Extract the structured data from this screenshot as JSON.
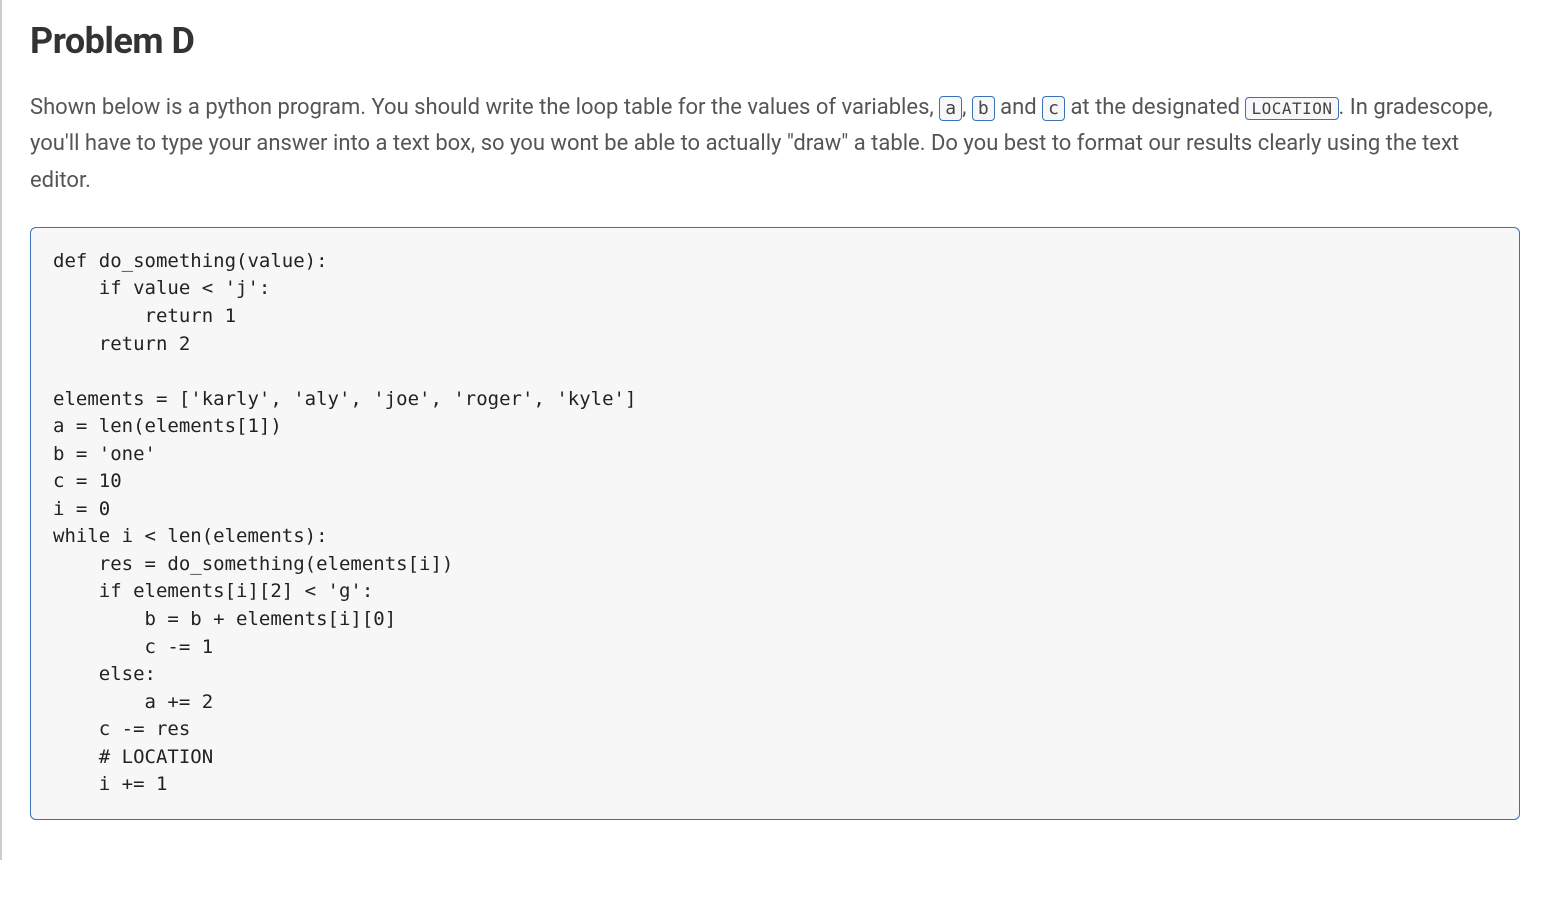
{
  "title": "Problem D",
  "description": {
    "part1": "Shown below is a python program. You should write the loop table for the values of variables, ",
    "var_a": "a",
    "part2": ", ",
    "var_b": "b",
    "part3": " and ",
    "var_c": "c",
    "part4": " at the designated ",
    "location_label": "LOCATION",
    "part5": ". In gradescope, you'll have to type your answer into a text box, so you wont be able to actually \"draw\" a table. Do you best to format our results clearly using the text editor."
  },
  "code": "def do_something(value):\n    if value < 'j':\n        return 1\n    return 2\n\nelements = ['karly', 'aly', 'joe', 'roger', 'kyle']\na = len(elements[1])\nb = 'one'\nc = 10\ni = 0\nwhile i < len(elements):\n    res = do_something(elements[i])\n    if elements[i][2] < 'g':\n        b = b + elements[i][0]\n        c -= 1\n    else:\n        a += 2\n    c -= res\n    # LOCATION\n    i += 1"
}
